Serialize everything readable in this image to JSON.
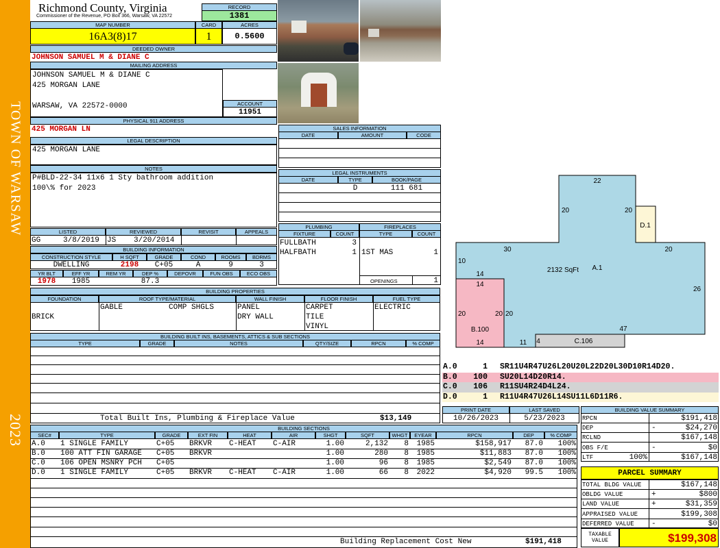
{
  "sidebar": {
    "town": "TOWN OF WARSAW",
    "year": "2023"
  },
  "header": {
    "county": "Richmond County, Virginia",
    "commissioner": "Commissioner of the Revenue, PO Box 366, Warsaw, VA 22572",
    "record_label": "RECORD",
    "record": "1381"
  },
  "labels": {
    "map_number": "MAP NUMBER",
    "card": "CARD",
    "acres": "ACRES",
    "deeded_owner": "DEEDED OWNER",
    "mailing_address": "MAILING ADDRESS",
    "account": "ACCOUNT",
    "physical_address": "PHYSICAL 911 ADDRESS",
    "legal_description": "LEGAL DESCRIPTION",
    "notes": "NOTES",
    "listed": "LISTED",
    "reviewed": "REVIEWED",
    "revisit": "REVISIT",
    "appeals": "APPEALS",
    "building_information": "BUILDING INFORMATION",
    "construction_style": "CONSTRUCTION STYLE",
    "h_sqft": "H SQFT",
    "grade": "GRADE",
    "cond": "COND",
    "rooms": "ROOMS",
    "bdrms": "BDRMS",
    "yr_blt": "YR BLT",
    "eff_yr": "EFF YR",
    "rem_yr": "REM YR",
    "dep_pct": "DEP %",
    "depovr": "DEPOVR",
    "fun_obs": "FUN OBS",
    "eco_obs": "ECO OBS",
    "building_properties": "BUILDING PROPERTIES",
    "foundation": "FOUNDATION",
    "roof": "ROOF TYPE/MATERIAL",
    "wall_finish": "WALL FINISH",
    "floor_finish": "FLOOR FINISH",
    "fuel_type": "FUEL TYPE",
    "builtins_title": "BUILDING BUILT INS, BASEMENTS, ATTICS & SUB SECTIONS",
    "type": "TYPE",
    "notes_col": "NOTES",
    "qty_size": "QTY/SIZE",
    "rpcn": "RPCN",
    "pct_comp": "% COMP",
    "sales_information": "SALES INFORMATION",
    "date": "DATE",
    "amount": "AMOUNT",
    "code": "CODE",
    "legal_instruments": "LEGAL INSTRUMENTS",
    "bookpage": "BOOK/PAGE",
    "plumbing": "PLUMBING",
    "fixture": "FIXTURE",
    "count": "COUNT",
    "fireplaces": "FIREPLACES",
    "openings": "OPENINGS",
    "print_date": "PRINT DATE",
    "last_saved": "LAST SAVED",
    "building_value_summary": "BUILDING VALUE SUMMARY",
    "building_sections": "BUILDING SECTIONS",
    "sec": "SEC#",
    "ext_fin": "EXT FIN",
    "heat": "HEAT",
    "air": "AIR",
    "shgt": "SHGT",
    "sqft": "SQFT",
    "whgt": "WHGT",
    "eyear": "EYEAR",
    "dep": "DEP"
  },
  "parcel": {
    "map_number": "16A3(8)17",
    "card": "1",
    "acres": "0.5600",
    "owner": "JOHNSON SAMUEL M & DIANE C",
    "mailing": [
      "JOHNSON SAMUEL M & DIANE C",
      "425 MORGAN LANE",
      "WARSAW, VA 22572-0000"
    ],
    "account": "11951",
    "physical_address": "425 MORGAN LN",
    "legal_description": "425 MORGAN LANE",
    "notes": [
      "P#BLD-22-34 11x6 1 Sty bathroom addition",
      "100\\% for 2023"
    ]
  },
  "review": {
    "listed_by": "GG",
    "listed_date": "3/8/2019",
    "reviewed_by": "JS",
    "reviewed_date": "3/20/2014",
    "revisit": "",
    "appeals": ""
  },
  "building": {
    "style": "DWELLING",
    "h_sqft": "2198",
    "grade": "C+05",
    "cond": "A",
    "rooms": "9",
    "bdrms": "3",
    "yr_blt": "1978",
    "eff_yr": "1985",
    "rem_yr": "",
    "dep_pct": "87.3",
    "depovr": "",
    "fun_obs": "",
    "eco_obs": ""
  },
  "properties": {
    "foundation": "BRICK",
    "roof_type": "GABLE",
    "roof_material": "COMP SHGLS",
    "walls": [
      "PANEL",
      "DRY WALL"
    ],
    "floors": [
      "CARPET",
      "TILE",
      "VINYL"
    ],
    "fuel": "ELECTRIC"
  },
  "builtins_total_label": "Total Built Ins, Plumbing & Fireplace Value",
  "builtins_total": "$13,149",
  "sales": [],
  "legal_instruments": [
    {
      "date": "",
      "type": "D",
      "bookpage": "111 681"
    }
  ],
  "plumbing": [
    {
      "fixture": "FULLBATH",
      "count": "3"
    },
    {
      "fixture": "HALFBATH",
      "count": "1"
    }
  ],
  "fireplaces": [
    {
      "type": "1ST MAS",
      "count": "1"
    }
  ],
  "openings": "1",
  "sketch": {
    "area_label": "A.1",
    "area_sqft": "2132 SqFt",
    "b_label": "B.100",
    "c_label": "C.106",
    "d_label": "D.1",
    "dims": {
      "d22": "22",
      "d20a": "20",
      "d20b": "20",
      "d30": "30",
      "d20c": "20",
      "d10": "10",
      "d14a": "14",
      "d14b": "14",
      "d26": "26",
      "d20d": "20",
      "d20e": "20",
      "d20f": "20",
      "d47": "47",
      "d14c": "14",
      "d11": "11",
      "d4": "4"
    }
  },
  "vectors": [
    {
      "code": "A.0",
      "num": "1",
      "path": "SR11U4R47U26L20U20L22D20L30D10R14D20.",
      "color": "#ffffff"
    },
    {
      "code": "B.0",
      "num": "100",
      "path": "SU20L14D20R14.",
      "color": "#f6b8c4"
    },
    {
      "code": "C.0",
      "num": "106",
      "path": "R11SU4R24D4L24.",
      "color": "#d3d3d3"
    },
    {
      "code": "D.0",
      "num": "1",
      "path": "R11U4R47U26L14SU11L6D11R6.",
      "color": "#fdf6d6"
    }
  ],
  "dates": {
    "print": "10/26/2023",
    "saved": "5/23/2023"
  },
  "bvs": [
    {
      "label": "RPCN",
      "sign": "",
      "value": "$191,418"
    },
    {
      "label": "DEP",
      "sign": "-",
      "value": "$24,270"
    },
    {
      "label": "RCLND",
      "sign": "",
      "value": "$167,148"
    },
    {
      "label": "OBS F/E",
      "sign": "-",
      "value": "$0"
    },
    {
      "label": "LTF",
      "pct": "100%",
      "sign": "",
      "value": "$167,148"
    }
  ],
  "summary": {
    "title": "PARCEL SUMMARY",
    "rows": [
      {
        "label": "TOTAL BLDG VALUE",
        "sign": "",
        "value": "$167,148"
      },
      {
        "label": "OBLDG VALUE",
        "sign": "+",
        "value": "$800"
      },
      {
        "label": "LAND VALUE",
        "sign": "+",
        "value": "$31,359"
      },
      {
        "label": "APPRAISED VALUE",
        "sign": "",
        "value": "$199,308"
      },
      {
        "label": "DEFERRED VALUE",
        "sign": "-",
        "value": "$0"
      }
    ],
    "taxable_label": "TAXABLE VALUE",
    "taxable": "$199,308"
  },
  "sections": [
    {
      "sec": "A.0",
      "type": "1 SINGLE FAMILY",
      "grade": "C+05",
      "ext": "BRKVR",
      "heat": "C-HEAT",
      "air": "C-AIR",
      "shgt": "1.00",
      "sqft": "2,132",
      "whgt": "8",
      "eyear": "1985",
      "rpcn": "$158,917",
      "dep": "87.0",
      "comp": "100%"
    },
    {
      "sec": "B.0",
      "type": "100 ATT FIN GARAGE",
      "grade": "C+05",
      "ext": "BRKVR",
      "heat": "",
      "air": "",
      "shgt": "1.00",
      "sqft": "280",
      "whgt": "8",
      "eyear": "1985",
      "rpcn": "$11,883",
      "dep": "87.0",
      "comp": "100%"
    },
    {
      "sec": "C.0",
      "type": "106 OPEN MSNRY PCH",
      "grade": "C+05",
      "ext": "",
      "heat": "",
      "air": "",
      "shgt": "1.00",
      "sqft": "96",
      "whgt": "8",
      "eyear": "1985",
      "rpcn": "$2,549",
      "dep": "87.0",
      "comp": "100%"
    },
    {
      "sec": "D.0",
      "type": "1 SINGLE FAMILY",
      "grade": "C+05",
      "ext": "BRKVR",
      "heat": "C-HEAT",
      "air": "C-AIR",
      "shgt": "1.00",
      "sqft": "66",
      "whgt": "8",
      "eyear": "2022",
      "rpcn": "$4,920",
      "dep": "99.5",
      "comp": "100%"
    }
  ],
  "replacement_label": "Building Replacement Cost New",
  "replacement": "$191,418"
}
